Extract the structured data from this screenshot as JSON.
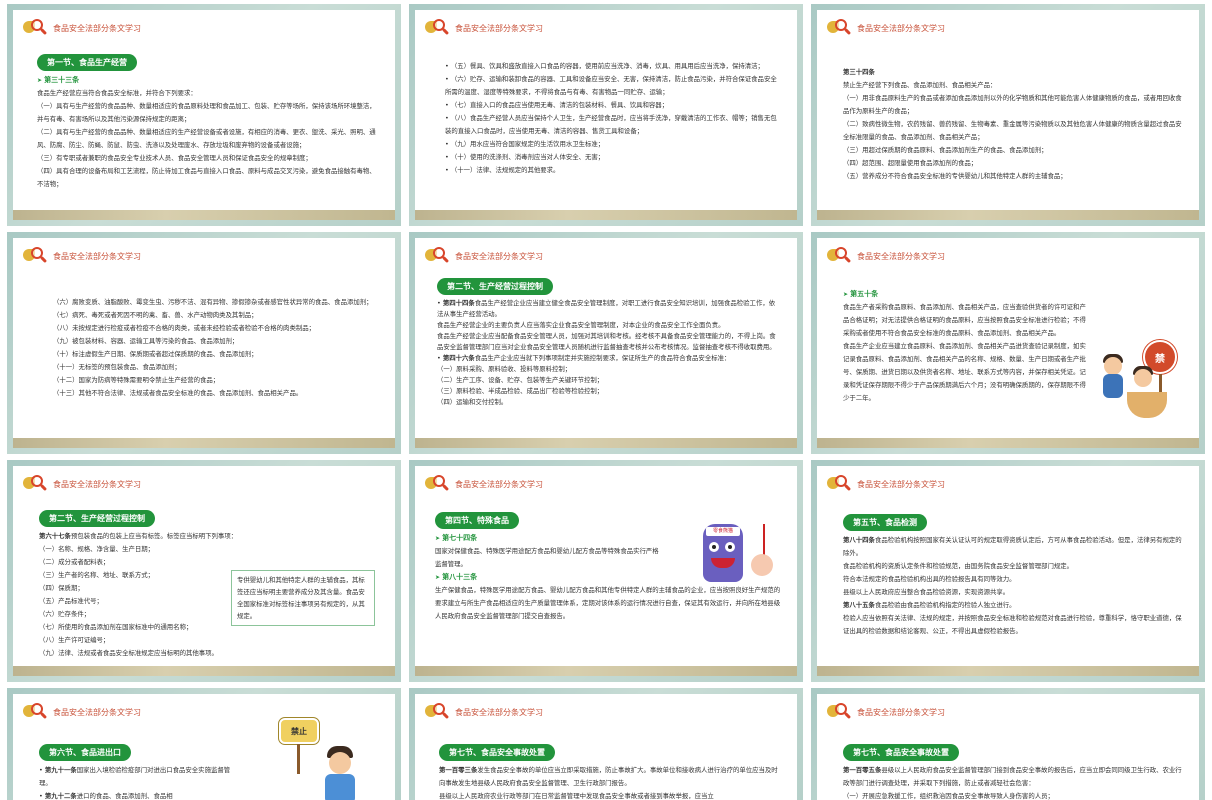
{
  "header": "食品安全法部分条文学习",
  "slides": [
    {
      "section": "第一节、食品生产经营",
      "article": "第三十三条",
      "lines": [
        "食品生产经营应当符合食品安全标准，并符合下列要求：",
        "（一）具有与生产经营的食品品种、数量相适应的食品原料处理和食品加工、包装、贮存等场所，保持该场所环境整洁，并与有毒、有害场所以及其他污染源保持规定的距离；",
        "（二）具有与生产经营的食品品种、数量相适应的生产经营设备或者设施，有相应的消毒、更衣、盥洗、采光、照明、通风、防腐、防尘、防蝇、防鼠、防虫、洗涤以及处理废水、存放垃圾和废弃物的设备或者设施；",
        "（三）有专职或者兼职的食品安全专业技术人员、食品安全管理人员和保证食品安全的规章制度；",
        "（四）具有合理的设备布局和工艺流程，防止待加工食品与直接入口食品、原料与成品交叉污染，避免食品接触有毒物、不洁物；"
      ]
    },
    {
      "lines": [
        "（五）餐具、饮具和盛放直接入口食品的容器，使用前应当洗净、消毒，炊具、用具用后应当洗净，保持清洁；",
        "（六）贮存、运输和装卸食品的容器、工具和设备应当安全、无害，保持清洁，防止食品污染，并符合保证食品安全所需的温度、湿度等特殊要求，不得将食品与有毒、有害物品一同贮存、运输；",
        "（七）直接入口的食品应当使用无毒、清洁的包装材料、餐具、饮具和容器；",
        "（八）食品生产经营人员应当保持个人卫生，生产经营食品时，应当将手洗净，穿戴清洁的工作衣、帽等；销售无包装的直接入口食品时，应当使用无毒、清洁的容器、售货工具和设备；",
        "（九）用水应当符合国家规定的生活饮用水卫生标准；",
        "（十）使用的洗涤剂、消毒剂应当对人体安全、无害；",
        "（十一）法律、法规规定的其他要求。"
      ]
    },
    {
      "article": "第三十四条",
      "lines": [
        "禁止生产经营下列食品、食品添加剂、食品相关产品：",
        "（一）用非食品原料生产的食品或者添加食品添加剂以外的化学物质和其他可能危害人体健康物质的食品，或者用回收食品作为原料生产的食品；",
        "（二）致病性微生物，农药残留、兽药残留、生物毒素、重金属等污染物质以及其他危害人体健康的物质含量超过食品安全标准限量的食品、食品添加剂、食品相关产品；",
        "（三）用超过保质期的食品原料、食品添加剂生产的食品、食品添加剂；",
        "（四）超范围、超限量使用食品添加剂的食品；",
        "（五）营养成分不符合食品安全标准的专供婴幼儿和其他特定人群的主辅食品；"
      ]
    },
    {
      "lines": [
        "（六）腐败变质、油脂酸败、霉变生虫、污秽不洁、混有异物、掺假掺杂或者感官性状异常的食品、食品添加剂；",
        "（七）病死、毒死或者死因不明的禽、畜、兽、水产动物肉类及其制品；",
        "（八）未按规定进行检疫或者检疫不合格的肉类，或者未经检验或者检验不合格的肉类制品；",
        "（九）被包装材料、容器、运输工具等污染的食品、食品添加剂；",
        "（十）标注虚假生产日期、保质期或者超过保质期的食品、食品添加剂；",
        "（十一）无标签的预包装食品、食品添加剂；",
        "（十二）国家为防病等特殊需要明令禁止生产经营的食品；",
        "（十三）其他不符合法律、法规或者食品安全标准的食品、食品添加剂、食品相关产品。"
      ]
    },
    {
      "section": "第二节、生产经营过程控制",
      "article_a": "第四十四条",
      "text_a": "食品生产经营企业应当建立健全食品安全管理制度，对职工进行食品安全知识培训，加强食品检验工作，依法从事生产经营活动。",
      "lines_a": [
        "食品生产经营企业的主要负责人应当落实企业食品安全管理制度，对本企业的食品安全工作全面负责。",
        "食品生产经营企业应当配备食品安全管理人员，加强对其培训和考核。经考核不具备食品安全管理能力的，不得上岗。食品安全监督管理部门应当对企业食品安全管理人员随机进行监督抽查考核并公布考核情况。监督抽查考核不得收取费用。"
      ],
      "article_b": "第四十六条",
      "text_b": "食品生产企业应当就下列事项制定并实施控制要求，保证所生产的食品符合食品安全标准：",
      "lines_b": [
        "（一）原料采购、原料验收、投料等原料控制；",
        "（二）生产工序、设备、贮存、包装等生产关键环节控制；",
        "（三）原料检验、半成品检验、成品出厂检验等检验控制；",
        "（四）运输和交付控制。"
      ]
    },
    {
      "article": "第五十条",
      "lines": [
        "食品生产者采购食品原料、食品添加剂、食品相关产品，应当查验供货者的许可证和产品合格证明；对无法提供合格证明的食品原料，应当按照食品安全标准进行检验；不得采购或者使用不符合食品安全标准的食品原料、食品添加剂、食品相关产品。",
        "食品生产企业应当建立食品原料、食品添加剂、食品相关产品进货查验记录制度，如实记录食品原料、食品添加剂、食品相关产品的名称、规格、数量、生产日期或者生产批号、保质期、进货日期以及供货者名称、地址、联系方式等内容，并保存相关凭证。记录和凭证保存期限不得少于产品保质期满后六个月；没有明确保质期的，保存期限不得少于二年。"
      ],
      "sign": "禁"
    },
    {
      "section": "第二节、生产经营过程控制",
      "article": "第六十七条",
      "lead": "预包装食品的包装上应当有标签。标签应当标明下列事项：",
      "lines": [
        "（一）名称、规格、净含量、生产日期；",
        "（二）成分或者配料表；",
        "（三）生产者的名称、地址、联系方式；",
        "（四）保质期；",
        "（五）产品标准代号；",
        "（六）贮存条件；",
        "（七）所使用的食品添加剂在国家标准中的通用名称；",
        "（八）生产许可证编号；",
        "（九）法律、法规或者食品安全标准规定应当标明的其他事项。"
      ],
      "note": "专供婴幼儿和其他特定人群的主辅食品，其标签还应当标明主要营养成分及其含量。食品安全国家标准对标签标注事项另有规定的，从其规定。"
    },
    {
      "section": "第四节、特殊食品",
      "article_a": "第七十四条",
      "text_a": "国家对保健食品、特殊医学用途配方食品和婴幼儿配方食品等特殊食品实行严格监督管理。",
      "article_b": "第八十三条",
      "text_b": "生产保健食品，特殊医学用途配方食品、婴幼儿配方食品和其他专供特定人群的主辅食品的企业，应当按照良好生产规范的要求建立与所生产食品相适应的生产质量管理体系，定期对该体系的运行情况进行自查，保证其有效运行，并向所在地县级人民政府食品安全监督管理部门提交自查报告。",
      "monster_label": "零食熊猫"
    },
    {
      "section": "第五节、食品检测",
      "article_a": "第八十四条",
      "text_a": "食品检验机构按照国家有关认证认可的规定取得资质认定后，方可从事食品检验活动。但是，法律另有规定的除外。",
      "lines_a": [
        "食品检验机构的资质认定条件和检验规范，由国务院食品安全监督管理部门规定。",
        "符合本法规定的食品检验机构出具的检验报告具有同等效力。",
        "县级以上人民政府应当整合食品检验资源，实现资源共享。"
      ],
      "article_b": "第八十五条",
      "text_b": "食品检验由食品检验机构指定的检验人独立进行。",
      "lines_b": [
        "检验人应当依照有关法律、法规的规定，并按照食品安全标准和检验规范对食品进行检验，尊重科学，恪守职业道德，保证出具的检验数据和结论客观、公正，不得出具虚假检验报告。"
      ]
    },
    {
      "section": "第六节、食品进出口",
      "article_a": "第九十一条",
      "text_a": "国家出入境检验检疫部门对进出口食品安全实施监督管理。",
      "article_b": "第九十二条",
      "text_b": "进口的食品、食品添加剂、食品相",
      "sign": "禁止"
    },
    {
      "section": "第七节、食品安全事故处置",
      "article_a": "第一百零三条",
      "text_a": "发生食品安全事故的单位应当立即采取措施，防止事故扩大。事故单位和接收病人进行治疗的单位应当及时向事故发生地县级人民政府食品安全监督管理、卫生行政部门报告。",
      "lines_a": [
        "县级以上人民政府农业行政等部门在日常监督管理中发现食品安全事故或者接到事故举报，应当立"
      ]
    },
    {
      "section": "第七节、食品安全事故处置",
      "article_a": "第一百零五条",
      "text_a": "县级以上人民政府食品安全监督管理部门接到食品安全事故的报告后，应当立即会同同级卫生行政、农业行政等部门进行调查处理，并采取下列措施，防止或者减轻社会危害：",
      "lines_a": [
        "（一）开展应急救援工作，组织救治因食品安全事故导致人身伤害的人员；"
      ]
    }
  ]
}
